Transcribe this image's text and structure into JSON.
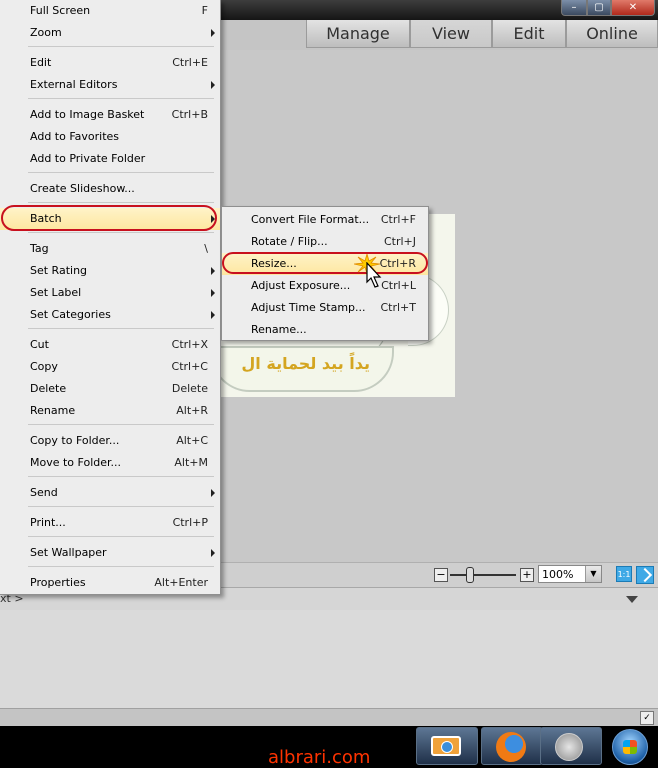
{
  "mode_tabs": [
    "Manage",
    "View",
    "Edit",
    "Online"
  ],
  "main_menu": [
    {
      "label": "Full Screen",
      "shortcut": "F"
    },
    {
      "label": "Zoom",
      "submenu": true
    },
    {
      "label": "Edit",
      "shortcut": "Ctrl+E"
    },
    {
      "label": "External Editors",
      "submenu": true
    },
    {
      "label": "Add to Image Basket",
      "shortcut": "Ctrl+B"
    },
    {
      "label": "Add to Favorites",
      "shortcut": ""
    },
    {
      "label": "Add to Private Folder",
      "shortcut": ""
    },
    {
      "label": "Create Slideshow...",
      "shortcut": ""
    },
    {
      "label": "Batch",
      "submenu": true
    },
    {
      "label": "Tag",
      "shortcut": "\\"
    },
    {
      "label": "Set Rating",
      "submenu": true
    },
    {
      "label": "Set Label",
      "submenu": true
    },
    {
      "label": "Set Categories",
      "submenu": true
    },
    {
      "label": "Cut",
      "shortcut": "Ctrl+X"
    },
    {
      "label": "Copy",
      "shortcut": "Ctrl+C"
    },
    {
      "label": "Delete",
      "shortcut": "Delete"
    },
    {
      "label": "Rename",
      "shortcut": "Alt+R"
    },
    {
      "label": "Copy to Folder...",
      "shortcut": "Alt+C"
    },
    {
      "label": "Move to Folder...",
      "shortcut": "Alt+M"
    },
    {
      "label": "Send",
      "submenu": true
    },
    {
      "label": "Print...",
      "shortcut": "Ctrl+P"
    },
    {
      "label": "Set Wallpaper",
      "submenu": true
    },
    {
      "label": "Properties",
      "shortcut": "Alt+Enter"
    }
  ],
  "batch_submenu": [
    {
      "label": "Convert File Format...",
      "shortcut": "Ctrl+F"
    },
    {
      "label": "Rotate / Flip...",
      "shortcut": "Ctrl+J"
    },
    {
      "label": "Resize...",
      "shortcut": "Ctrl+R"
    },
    {
      "label": "Adjust Exposure...",
      "shortcut": "Ctrl+L"
    },
    {
      "label": "Adjust Time Stamp...",
      "shortcut": "Ctrl+T"
    },
    {
      "label": "Rename...",
      "shortcut": ""
    }
  ],
  "image_arabic_text": "يداً بيد لحماية ال",
  "zoom": {
    "value": "100%",
    "minus": "−",
    "plus": "+",
    "one_to_one": "1:1"
  },
  "info_strip": {
    "crumb": "xt >"
  },
  "watermark": "albrari.com",
  "window_controls": {
    "close": "✕",
    "max": "▢",
    "min": "–"
  },
  "statusbar": {
    "grip": "✓"
  },
  "colors": {
    "highlight": "#fde7a0",
    "annotation": "#c8101e",
    "taskbar": "#000000"
  }
}
